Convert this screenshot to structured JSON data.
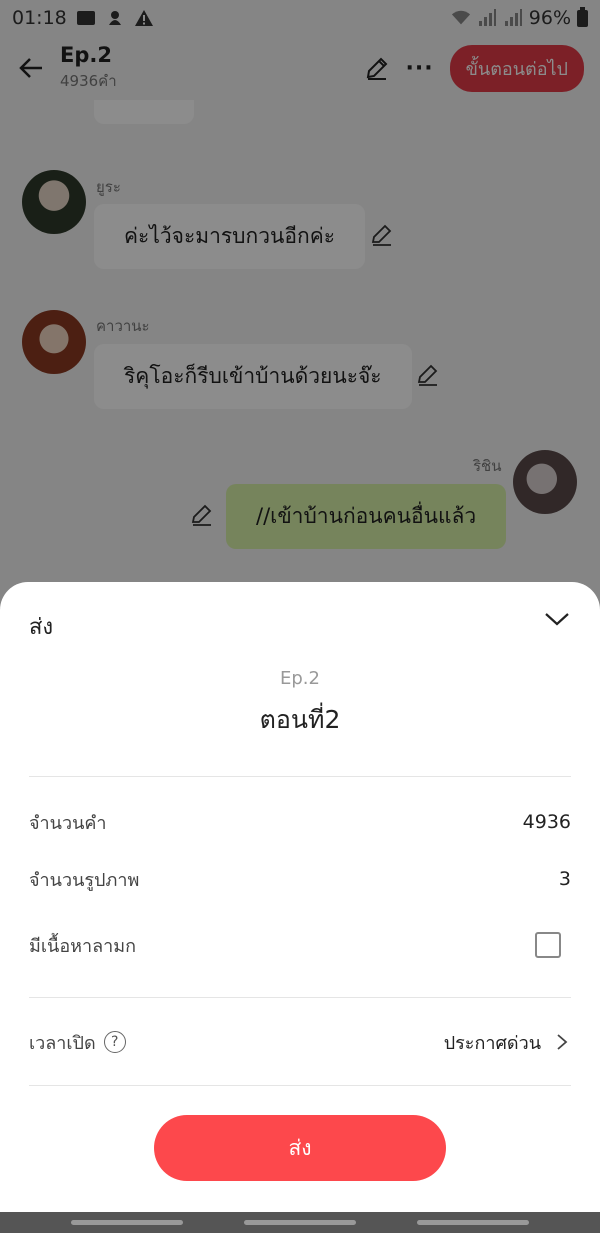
{
  "status_bar": {
    "time": "01:18",
    "battery": "96%"
  },
  "header": {
    "title": "Ep.2",
    "subtitle": "4936คำ",
    "next_label": "ขั้นตอนต่อไป",
    "more": "···"
  },
  "chat": {
    "messages": [
      {
        "name": "ยูระ",
        "text": "ค่ะไว้จะมารบกวนอีกค่ะ"
      },
      {
        "name": "คาวานะ",
        "text": "ริคุโอะก็รีบเข้าบ้านด้วยนะจ๊ะ"
      },
      {
        "name": "ริชิน",
        "text": "//เข้าบ้านก่อนคนอื่นแล้ว"
      }
    ]
  },
  "sheet": {
    "title": "ส่ง",
    "episode_label": "Ep.2",
    "episode_name": "ตอนที่2",
    "rows": [
      {
        "label": "จำนวนคำ",
        "value": "4936"
      },
      {
        "label": "จำนวนรูปภาพ",
        "value": "3"
      },
      {
        "label": "มีเนื้อหาลามก"
      }
    ],
    "open_time": {
      "label": "เวลาเปิด",
      "help": "?",
      "value": "ประกาศด่วน"
    },
    "send_label": "ส่ง"
  },
  "colors": {
    "accent": "#fd484c",
    "my_bubble": "#d7f0a8",
    "next_button": "#e23b47"
  }
}
